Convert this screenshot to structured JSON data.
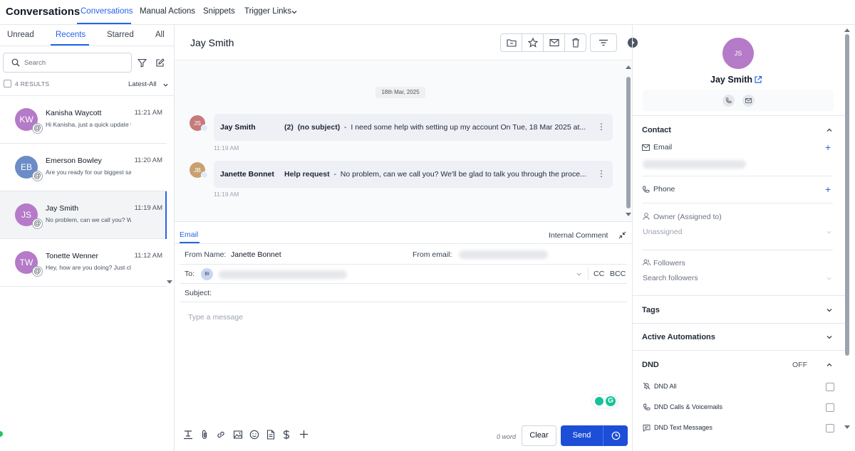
{
  "topnav": {
    "title": "Conversations",
    "tabs": [
      "Conversations",
      "Manual Actions",
      "Snippets",
      "Trigger Links"
    ]
  },
  "left": {
    "tabs": [
      "Unread",
      "Recents",
      "Starred",
      "All"
    ],
    "search_placeholder": "Search",
    "results": "4 RESULTS",
    "sort": "Latest-All",
    "conversations": [
      {
        "initials": "KW",
        "name": "Kanisha Waycott",
        "time": "11:21 AM",
        "preview": "Hi Kanisha, just a quick update t",
        "color": "#b57ac8"
      },
      {
        "initials": "EB",
        "name": "Emerson Bowley",
        "time": "11:20 AM",
        "preview": "Are you ready for our biggest sa",
        "color": "#6b8cc7"
      },
      {
        "initials": "JS",
        "name": "Jay Smith",
        "time": "11:19 AM",
        "preview": "No problem, can we call you? W",
        "color": "#b57ac8"
      },
      {
        "initials": "TW",
        "name": "Tonette Wenner",
        "time": "11:12 AM",
        "preview": "Hey, how are you doing? Just cl",
        "color": "#b57ac8"
      }
    ]
  },
  "thread": {
    "title": "Jay Smith",
    "date": "18th Mar, 2025",
    "messages": [
      {
        "initials": "JS",
        "sender": "Jay Smith",
        "count": "(2)",
        "subject": "(no subject)",
        "body": "I need some help with setting up my account On Tue, 18 Mar 2025 at...",
        "time": "11:19 AM",
        "color": "#c77a7a"
      },
      {
        "initials": "JB",
        "sender": "Janette Bonnet",
        "subject": "Help request",
        "body": "No problem, can we call you? We'll be glad to talk you through the proce...",
        "time": "11:19 AM",
        "color": "#c9a16e"
      }
    ]
  },
  "composer": {
    "tab": "Email",
    "internal": "Internal Comment",
    "from_name_label": "From Name:",
    "from_name": "Janette Bonnet",
    "from_email_label": "From email:",
    "to_label": "To:",
    "to_chip": "BI",
    "cc": "CC",
    "bcc": "BCC",
    "subject_label": "Subject:",
    "message_placeholder": "Type a message",
    "word_count": "0 word",
    "clear": "Clear",
    "send": "Send"
  },
  "contact": {
    "initials": "JS",
    "name": "Jay Smith",
    "section_contact": "Contact",
    "email_label": "Email",
    "phone_label": "Phone",
    "owner_label": "Owner (Assigned to)",
    "owner_value": "Unassigned",
    "followers_label": "Followers",
    "followers_placeholder": "Search followers",
    "tags": "Tags",
    "automations": "Active Automations",
    "dnd": "DND",
    "dnd_state": "OFF",
    "dnd_items": [
      "DND All",
      "DND Calls & Voicemails",
      "DND Text Messages"
    ]
  }
}
